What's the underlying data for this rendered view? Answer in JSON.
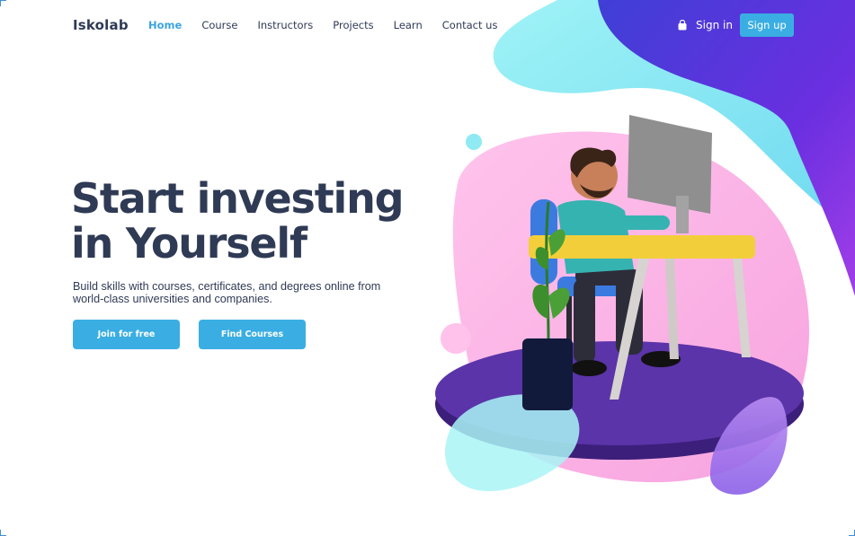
{
  "brand": {
    "logo_text": "Iskolab"
  },
  "nav": {
    "links": [
      {
        "label": "Home",
        "active": true
      },
      {
        "label": "Course",
        "active": false
      },
      {
        "label": "Instructors",
        "active": false
      },
      {
        "label": "Projects",
        "active": false
      },
      {
        "label": "Learn",
        "active": false
      },
      {
        "label": "Contact us",
        "active": false
      }
    ],
    "sign_in_label": "Sign in",
    "sign_in_icon": "shopping-bag-icon",
    "sign_up_label": "Sign up"
  },
  "hero": {
    "headline_line1": "Start investing",
    "headline_line2": "in Yourself",
    "subtext": "Build skills with courses, certificates, and degrees online from world-class universities and companies.",
    "primary_cta": "Join for free",
    "secondary_cta": "Find Courses"
  },
  "colors": {
    "accent": "#3aaee3",
    "text_dark": "#2f3a55",
    "blob_purple": "#5b2fd8",
    "blob_cyan": "#7fe7f2",
    "blob_pink": "#ffb3e6",
    "platform": "#4b2a8f"
  }
}
